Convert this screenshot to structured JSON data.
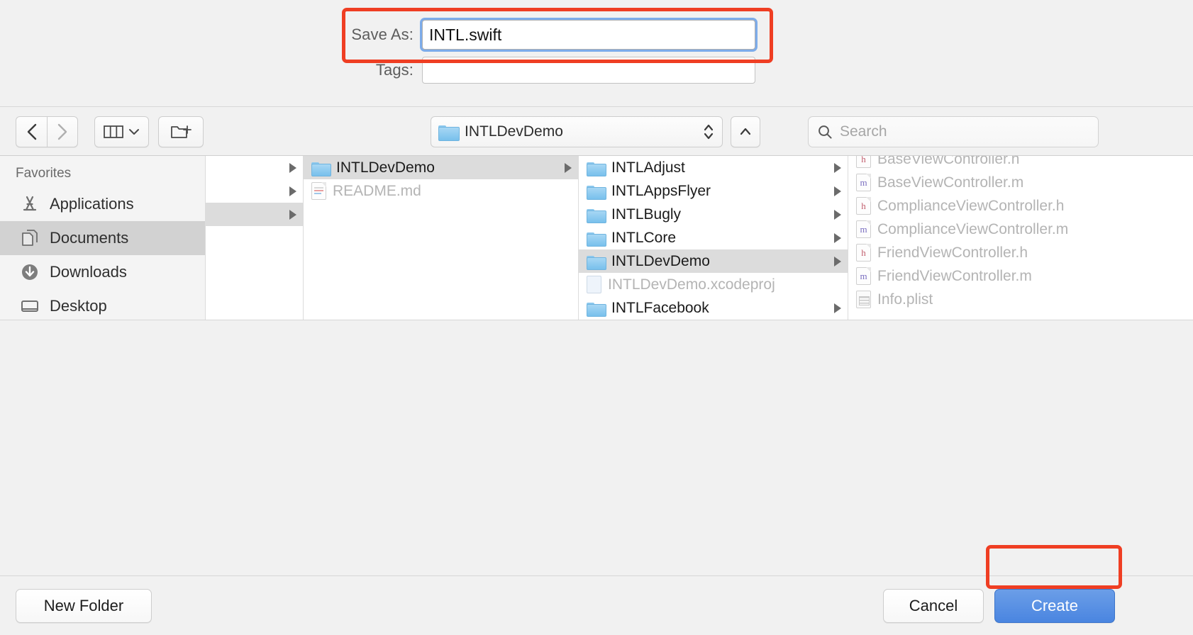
{
  "fields": {
    "save_as_label": "Save As:",
    "save_as_value": "INTL.swift",
    "tags_label": "Tags:",
    "tags_value": "",
    "tags_placeholder": ""
  },
  "toolbar": {
    "back_icon": "chevron-left-icon",
    "forward_icon": "chevron-right-icon",
    "view_icon": "column-view-icon",
    "view_chevron_icon": "chevron-down-icon",
    "new_folder_icon": "new-folder-icon",
    "path_label": "INTLDevDemo",
    "path_folder_icon": "folder-icon",
    "path_stepper_icon": "up-down-stepper-icon",
    "up_icon": "chevron-up-icon",
    "search_icon": "search-icon",
    "search_placeholder": "Search",
    "search_value": ""
  },
  "sidebar": {
    "header": "Favorites",
    "items": [
      {
        "label": "Applications",
        "icon": "applications-icon",
        "selected": false
      },
      {
        "label": "Documents",
        "icon": "documents-icon",
        "selected": true
      },
      {
        "label": "Downloads",
        "icon": "downloads-icon",
        "selected": false
      },
      {
        "label": "Desktop",
        "icon": "desktop-icon",
        "selected": false
      }
    ]
  },
  "columns": [
    {
      "name": "column-1",
      "rows": [
        {
          "label": "",
          "icon": "none",
          "selected": false,
          "dimmed": false,
          "arrow": true
        },
        {
          "label": "",
          "icon": "none",
          "selected": false,
          "dimmed": false,
          "arrow": true
        },
        {
          "label": "",
          "icon": "none",
          "selected": true,
          "dimmed": false,
          "arrow": true
        }
      ]
    },
    {
      "name": "column-2",
      "rows": [
        {
          "label": "INTLDevDemo",
          "icon": "folder-icon",
          "selected": true,
          "dimmed": false,
          "arrow": true
        },
        {
          "label": "README.md",
          "icon": "markdown-doc-icon",
          "selected": false,
          "dimmed": true,
          "arrow": false
        }
      ]
    },
    {
      "name": "column-3",
      "rows": [
        {
          "label": "INTLAdjust",
          "icon": "folder-icon",
          "selected": false,
          "dimmed": false,
          "arrow": true
        },
        {
          "label": "INTLAppsFlyer",
          "icon": "folder-icon",
          "selected": false,
          "dimmed": false,
          "arrow": true
        },
        {
          "label": "INTLBugly",
          "icon": "folder-icon",
          "selected": false,
          "dimmed": false,
          "arrow": true
        },
        {
          "label": "INTLCore",
          "icon": "folder-icon",
          "selected": false,
          "dimmed": false,
          "arrow": true
        },
        {
          "label": "INTLDevDemo",
          "icon": "folder-icon",
          "selected": true,
          "dimmed": false,
          "arrow": true
        },
        {
          "label": "INTLDevDemo.xcodeproj",
          "icon": "xcodeproj-icon",
          "selected": false,
          "dimmed": true,
          "arrow": false
        },
        {
          "label": "INTLFacebook",
          "icon": "folder-icon",
          "selected": false,
          "dimmed": false,
          "arrow": true
        }
      ]
    },
    {
      "name": "column-4",
      "rows": [
        {
          "label": "BaseViewController.h",
          "icon": "h-file-icon",
          "selected": false,
          "dimmed": true,
          "arrow": false
        },
        {
          "label": "BaseViewController.m",
          "icon": "m-file-icon",
          "selected": false,
          "dimmed": true,
          "arrow": false
        },
        {
          "label": "ComplianceViewController.h",
          "icon": "h-file-icon",
          "selected": false,
          "dimmed": true,
          "arrow": false
        },
        {
          "label": "ComplianceViewController.m",
          "icon": "m-file-icon",
          "selected": false,
          "dimmed": true,
          "arrow": false
        },
        {
          "label": "FriendViewController.h",
          "icon": "h-file-icon",
          "selected": false,
          "dimmed": true,
          "arrow": false
        },
        {
          "label": "FriendViewController.m",
          "icon": "m-file-icon",
          "selected": false,
          "dimmed": true,
          "arrow": false
        },
        {
          "label": "Info.plist",
          "icon": "plist-icon",
          "selected": false,
          "dimmed": true,
          "arrow": false
        }
      ]
    }
  ],
  "buttons": {
    "new_folder": "New Folder",
    "cancel": "Cancel",
    "create": "Create"
  },
  "colors": {
    "accent_blue": "#4a85e0",
    "focus_ring": "#68a0e9",
    "annotation_red": "#ef3e23",
    "selection_gray": "#dcdcdc",
    "folder_blue": "#78c0ec"
  }
}
